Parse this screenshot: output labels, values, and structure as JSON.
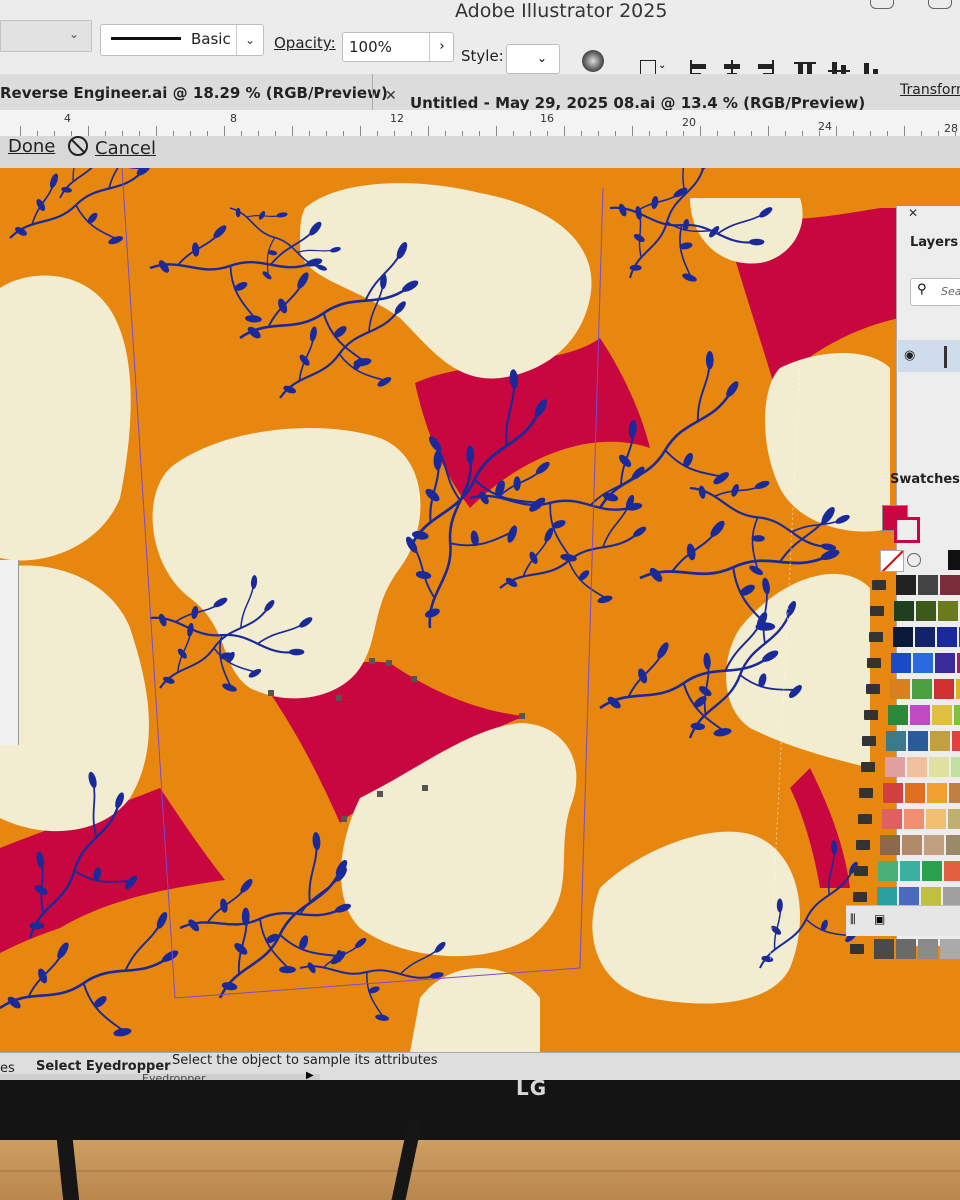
{
  "app": {
    "title": "Adobe Illustrator 2025"
  },
  "control_bar": {
    "stroke_profile": "Basic",
    "opacity_label": "Opacity:",
    "opacity_value": "100%",
    "style_label": "Style:",
    "transform_label": "Transform"
  },
  "tabs": [
    {
      "label": "Reverse Engineer.ai @ 18.29 % (RGB/Preview)"
    },
    {
      "label": "Untitled - May 29, 2025 08.ai @ 13.4 % (RGB/Preview)"
    }
  ],
  "ruler": {
    "marks": [
      "4",
      "8",
      "12",
      "16",
      "20",
      "24",
      "28"
    ]
  },
  "isolation_bar": {
    "done_label": "Done",
    "cancel_label": "Cancel"
  },
  "layers_panel": {
    "title": "Layers",
    "search_placeholder": "Sear"
  },
  "swatches_panel": {
    "title": "Swatches"
  },
  "status_bar": {
    "left_fragment": "es",
    "tool": "Select Eyedropper",
    "hint": "Select the object to sample its attributes",
    "tool_name": "Eyedropper"
  },
  "monitor": {
    "brand": "LG"
  },
  "colors": {
    "orange": "#e8870f",
    "cream": "#f2ecd0",
    "crimson": "#c8063f",
    "navy": "#1a2a9a"
  }
}
